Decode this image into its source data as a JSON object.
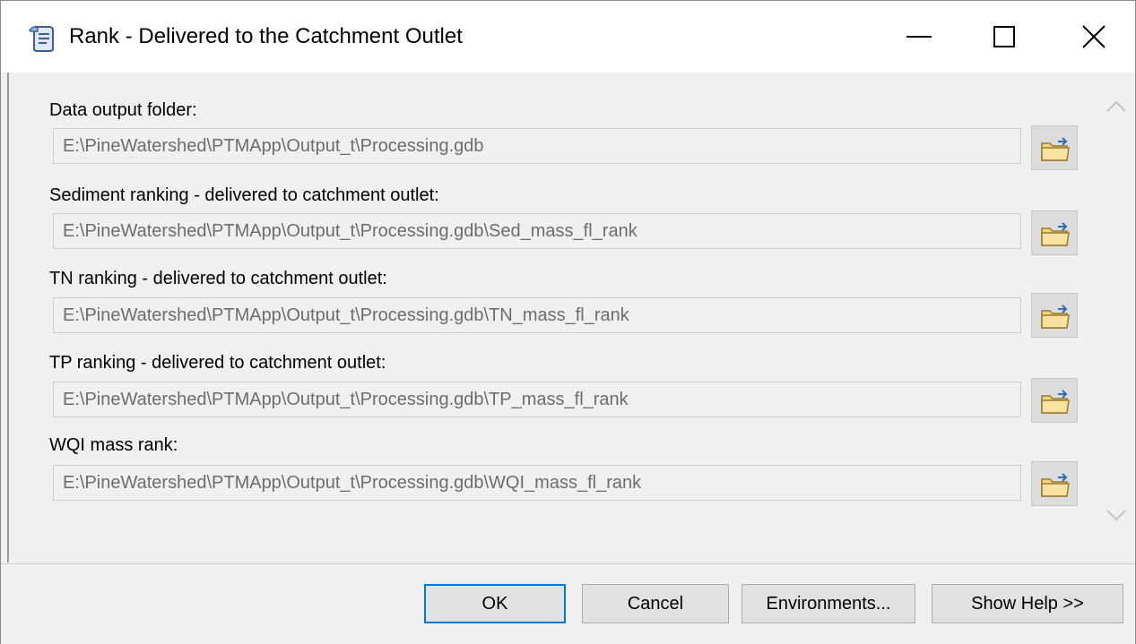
{
  "window": {
    "title": "Rank - Delivered to the Catchment Outlet",
    "app_icon": "script-tool-icon",
    "controls": [
      "minimize-icon",
      "maximize-icon",
      "close-icon"
    ]
  },
  "params": [
    {
      "label": "Data output folder:",
      "value": "E:\\PineWatershed\\PTMApp\\Output_t\\Processing.gdb"
    },
    {
      "label": "Sediment ranking - delivered to catchment outlet:",
      "value": "E:\\PineWatershed\\PTMApp\\Output_t\\Processing.gdb\\Sed_mass_fl_rank"
    },
    {
      "label": "TN ranking - delivered to catchment outlet:",
      "value": "E:\\PineWatershed\\PTMApp\\Output_t\\Processing.gdb\\TN_mass_fl_rank"
    },
    {
      "label": "TP ranking - delivered to catchment outlet:",
      "value": "E:\\PineWatershed\\PTMApp\\Output_t\\Processing.gdb\\TP_mass_fl_rank"
    },
    {
      "label": "WQI mass rank:",
      "value": "E:\\PineWatershed\\PTMApp\\Output_t\\Processing.gdb\\WQI_mass_fl_rank"
    }
  ],
  "browse_icon": "folder-browse-icon",
  "buttons": {
    "ok": "OK",
    "cancel": "Cancel",
    "environments": "Environments...",
    "show_help": "Show Help >>"
  },
  "colors": {
    "ok_border": "#0078d7",
    "disabled_text": "#6d6d6d"
  }
}
